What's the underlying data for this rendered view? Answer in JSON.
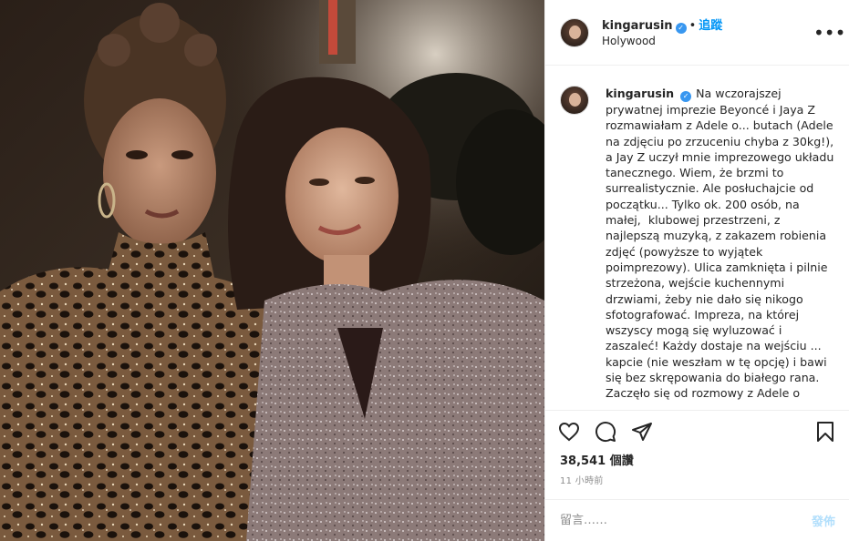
{
  "post": {
    "username": "kingarusin",
    "verified_glyph": "✓",
    "follow_label": "追蹤",
    "location": "Holywood",
    "more_label": "•••"
  },
  "caption": {
    "username": "kingarusin",
    "verified_glyph": "✓",
    "text": "Na wczorajszej prywatnej imprezie Beyoncé i Jaya Z rozmawiałam z Adele o... butach (Adele na zdjęciu po zrzuceniu chyba z 30kg!), a Jay Z uczył mnie imprezowego układu tanecznego. Wiem, że brzmi to surrealistycznie. Ale posłuchajcie od początku... Tylko ok. 200 osób, na małej,  klubowej przestrzeni, z najlepszą muzyką, z zakazem robienia zdjęć (powyższe to wyjątek poimprezowy). Ulica zamknięta i pilnie strzeżona, wejście kuchennymi drzwiami, żeby nie dało się nikogo sfotografować. Impreza, na której wszyscy mogą się wyluzować i zaszaleć! Każdy dostaje na wejściu ... kapcie (nie weszłam w tę opcję) i bawi się bez skrępowania do białego rana. Zaczęło się od rozmowy z Adele o"
  },
  "stats": {
    "likes": "38,541 個讚",
    "time": "11 小時前"
  },
  "comment_box": {
    "placeholder": "留言……",
    "post_label": "發佈"
  },
  "icons": {
    "like": "heart-icon",
    "comment": "comment-icon",
    "share": "paper-plane-icon",
    "save": "bookmark-icon",
    "more": "more-icon",
    "verified": "verified-badge-icon"
  },
  "colors": {
    "accent": "#0095f6",
    "verified": "#3897f0",
    "muted": "#8e8e8e",
    "post_button_disabled": "#b2dffc"
  }
}
